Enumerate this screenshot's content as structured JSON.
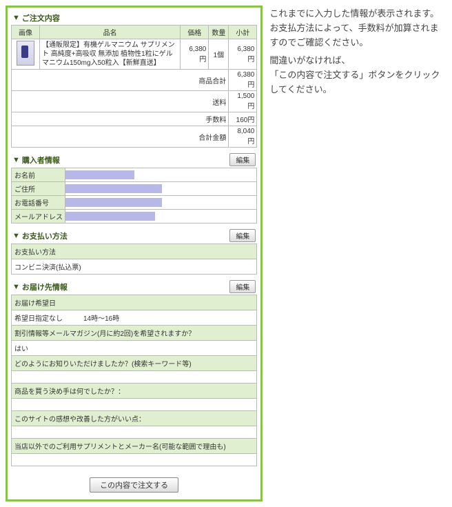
{
  "sections": {
    "order": {
      "title": "ご注文内容"
    },
    "buyer": {
      "title": "購入者情報",
      "edit": "編集"
    },
    "payment": {
      "title": "お支払い方法",
      "edit": "編集"
    },
    "delivery": {
      "title": "お届け先情報",
      "edit": "編集"
    }
  },
  "orderTable": {
    "headers": {
      "image": "画像",
      "name": "品名",
      "price": "価格",
      "qty": "数量",
      "subtotal": "小計"
    },
    "item": {
      "name": "【通販限定】有機ゲルマニウム サプリメント 高純度+高吸収 無添加 植物性1粒にゲルマニウム150mg入50粒入【新鮮直送】",
      "price": "6,380円",
      "qty": "1個",
      "subtotal": "6,380円"
    },
    "totals": [
      {
        "label": "商品合計",
        "value": "6,380円"
      },
      {
        "label": "送料",
        "value": "1,500円"
      },
      {
        "label": "手数料",
        "value": "160円"
      },
      {
        "label": "合計金額",
        "value": "8,040円"
      }
    ]
  },
  "buyer": {
    "rows": [
      "お名前",
      "ご住所",
      "お電話番号",
      "メールアドレス"
    ]
  },
  "payment": {
    "label": "お支払い方法",
    "value": "コンビニ決済(払込票)"
  },
  "delivery": {
    "dateLabel": "お届け希望日",
    "dateValue": "希望日指定なし　　　14時～16時",
    "q1": "割引情報等メールマガジン(月に約2回)を希望されますか？",
    "a1": "はい",
    "q2": "どのようにお知りいただけましたか？(検索キーワード等)",
    "q3": "商品を買う決め手は何でしたか？：",
    "q4": "このサイトの感想や改善した方がいい点：",
    "q5": "当店以外でのご利用サプリメントとメーカー名(可能な範囲で理由も)"
  },
  "submit": "この内容で注文する",
  "side": {
    "p1": "これまでに入力した情報が表示されます。",
    "p2": "お支払方法によって、手数料が加算されますのでご確認ください。",
    "p3": "間違いがなければ、",
    "p4": "「この内容で注文する」ボタンをクリックしてください。"
  }
}
